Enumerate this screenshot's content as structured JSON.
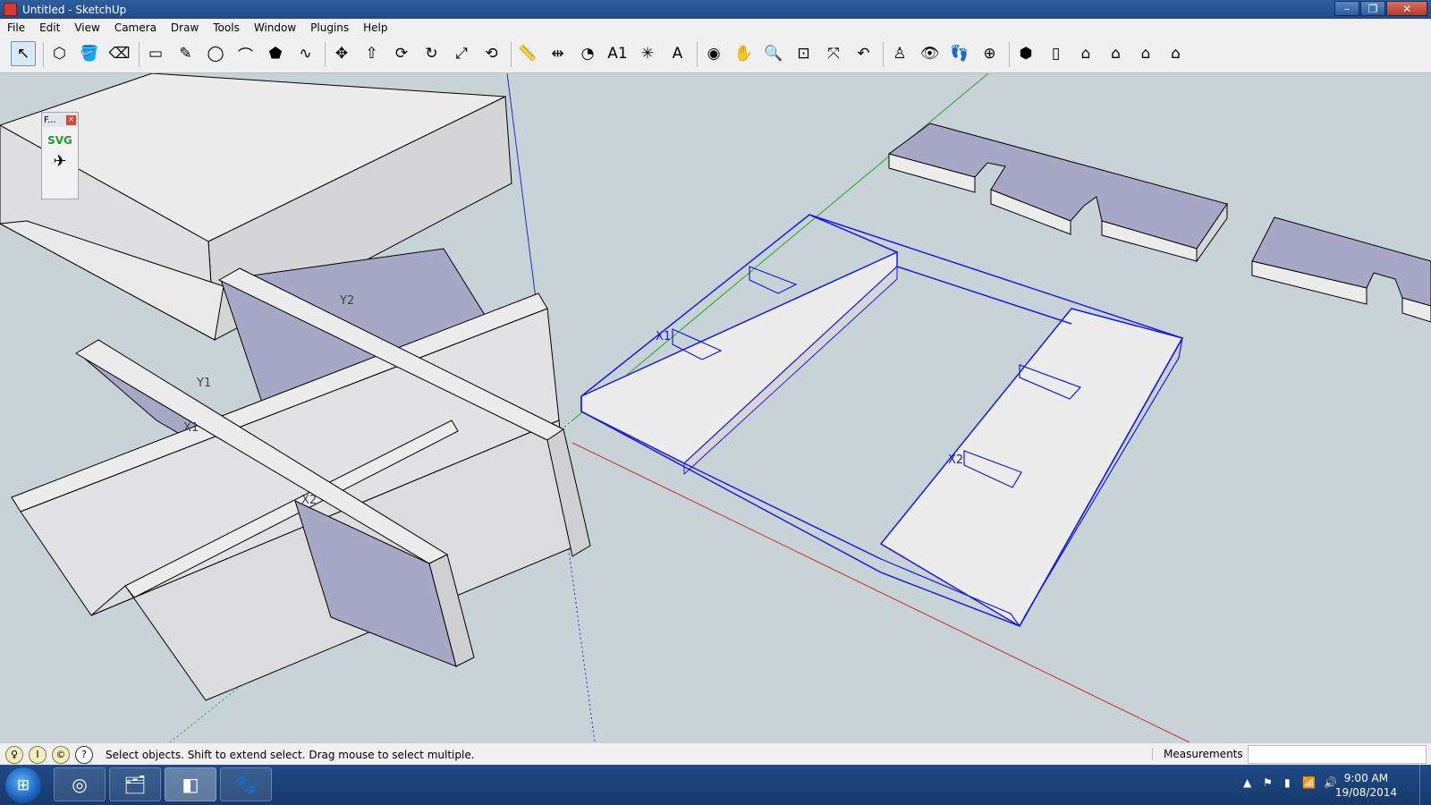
{
  "window": {
    "title": "Untitled - SketchUp",
    "controls": [
      "–",
      "❐",
      "✕"
    ]
  },
  "menu": [
    "File",
    "Edit",
    "View",
    "Camera",
    "Draw",
    "Tools",
    "Window",
    "Plugins",
    "Help"
  ],
  "toolbar": {
    "tools": [
      {
        "name": "select-tool",
        "glyph": "↖",
        "selected": true
      },
      {
        "name": "component-tool",
        "glyph": "⬡"
      },
      {
        "name": "paint-bucket-tool",
        "glyph": "🪣"
      },
      {
        "name": "eraser-tool",
        "glyph": "⌫"
      },
      {
        "name": "rectangle-tool",
        "glyph": "▭"
      },
      {
        "name": "line-tool",
        "glyph": "✎"
      },
      {
        "name": "circle-tool",
        "glyph": "◯"
      },
      {
        "name": "arc-tool",
        "glyph": "⌒"
      },
      {
        "name": "polygon-tool",
        "glyph": "⬟"
      },
      {
        "name": "freehand-tool",
        "glyph": "∿"
      },
      {
        "name": "move-tool",
        "glyph": "✥"
      },
      {
        "name": "push-pull-tool",
        "glyph": "⇧"
      },
      {
        "name": "rotate-tool",
        "glyph": "⟳"
      },
      {
        "name": "follow-me-tool",
        "glyph": "↻"
      },
      {
        "name": "scale-tool",
        "glyph": "⤢"
      },
      {
        "name": "offset-tool",
        "glyph": "⟲"
      },
      {
        "name": "tape-measure-tool",
        "glyph": "📏"
      },
      {
        "name": "dimension-tool",
        "glyph": "⇹"
      },
      {
        "name": "protractor-tool",
        "glyph": "◔"
      },
      {
        "name": "text-tool",
        "glyph": "A1"
      },
      {
        "name": "axes-tool",
        "glyph": "✳"
      },
      {
        "name": "3d-text-tool",
        "glyph": "A"
      },
      {
        "name": "orbit-tool",
        "glyph": "◉"
      },
      {
        "name": "pan-tool",
        "glyph": "✋"
      },
      {
        "name": "zoom-tool",
        "glyph": "🔍"
      },
      {
        "name": "zoom-window-tool",
        "glyph": "⊡"
      },
      {
        "name": "zoom-extents-tool",
        "glyph": "⤧"
      },
      {
        "name": "previous-view-tool",
        "glyph": "↶"
      },
      {
        "name": "position-camera-tool",
        "glyph": "♙"
      },
      {
        "name": "look-around-tool",
        "glyph": "👁"
      },
      {
        "name": "walk-tool",
        "glyph": "👣"
      },
      {
        "name": "section-plane-tool",
        "glyph": "⊕"
      },
      {
        "name": "iso-view-tool",
        "glyph": "⬢"
      },
      {
        "name": "top-view-tool",
        "glyph": "▯"
      },
      {
        "name": "front-view-tool",
        "glyph": "⌂"
      },
      {
        "name": "right-view-tool",
        "glyph": "⌂"
      },
      {
        "name": "back-view-tool",
        "glyph": "⌂"
      },
      {
        "name": "left-view-tool",
        "glyph": "⌂"
      }
    ]
  },
  "panel": {
    "title": "F...",
    "close": "×",
    "svg_label": "SVG",
    "icon": "✈"
  },
  "labels": {
    "x1_left": "X1",
    "x2_left": "X2",
    "y1_left": "Y1",
    "y2_left": "Y2",
    "x1_right": "X1",
    "x2_right": "X2"
  },
  "status": {
    "icons": [
      "♀",
      "Ⅰ",
      "©"
    ],
    "help_icon": "?",
    "text": "Select objects. Shift to extend select. Drag mouse to select multiple.",
    "measurements_label": "Measurements",
    "measurements_value": ""
  },
  "taskbar": {
    "start_icon": "⊞",
    "items": [
      {
        "name": "chrome-task",
        "glyph": "◎"
      },
      {
        "name": "explorer-task",
        "glyph": "🗂"
      },
      {
        "name": "sketchup-task",
        "glyph": "◧"
      },
      {
        "name": "gimp-task",
        "glyph": "🐾"
      }
    ],
    "tray_icons": [
      "▲",
      "⚑",
      "▮",
      "📶",
      "🔊"
    ],
    "time": "9:00 AM",
    "date": "19/08/2014"
  },
  "colors": {
    "background": "#c7d3d6",
    "face_light": "#e9e9ea",
    "face_top": "#a7a8c6",
    "selection": "#1a1adc",
    "axis_red": "#cc2a2a",
    "axis_green": "#2aa52a",
    "axis_blue": "#2a2ad0"
  }
}
